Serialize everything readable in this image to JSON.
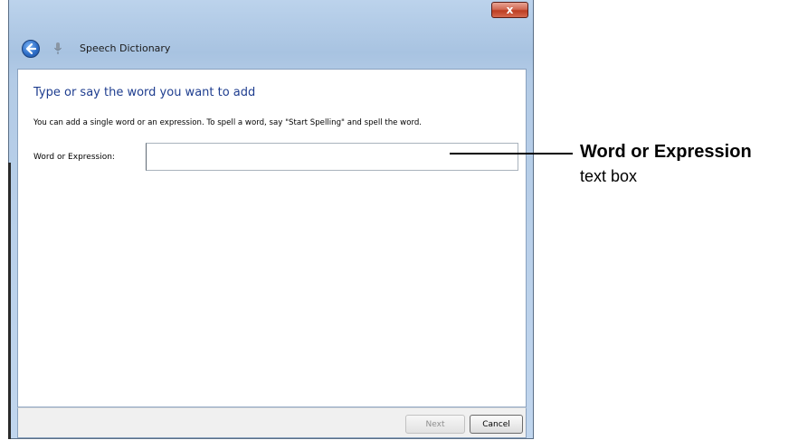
{
  "window": {
    "title": "Speech Dictionary",
    "close_label": "x"
  },
  "content": {
    "heading": "Type or say the word you want to add",
    "instructions": "You can add a single word or an expression.  To spell a word, say \"Start Spelling\" and spell the word.",
    "field_label": "Word or Expression:",
    "field_value": "",
    "field_placeholder": ""
  },
  "footer": {
    "next_label": "Next",
    "cancel_label": "Cancel"
  },
  "callout": {
    "title": "Word or Expression",
    "subtitle": "text box"
  },
  "icons": {
    "back": "back-arrow-icon",
    "microphone": "microphone-icon",
    "close": "close-icon"
  },
  "colors": {
    "heading": "#1e3d8f",
    "titlebar": "#b3cbe6",
    "close_button": "#c8452b"
  }
}
